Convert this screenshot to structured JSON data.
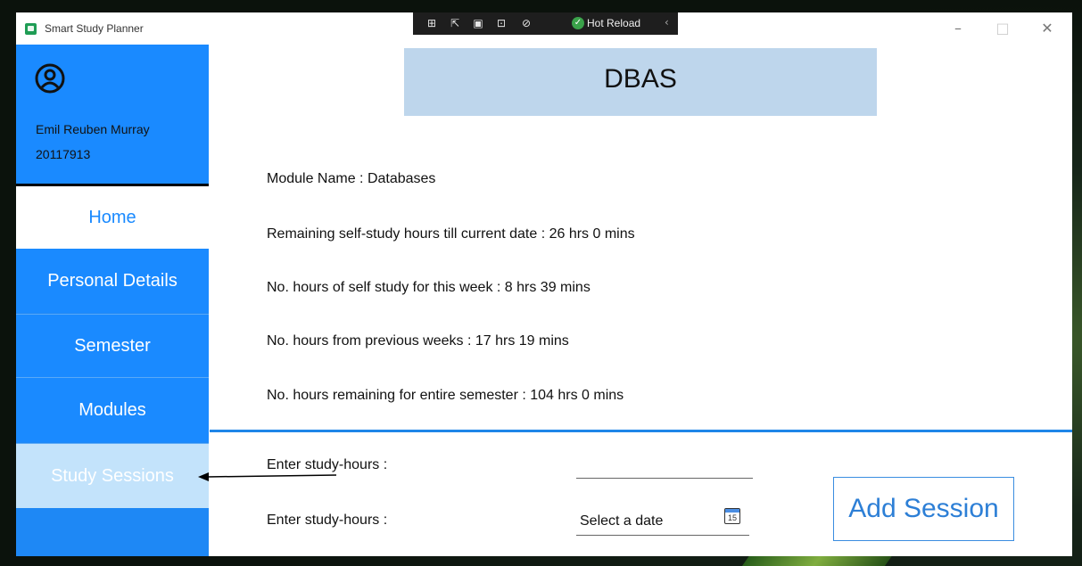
{
  "window": {
    "title": "Smart Study Planner"
  },
  "devtools": {
    "hot_reload_label": "Hot Reload"
  },
  "profile": {
    "name": "Emil Reuben Murray",
    "id": "20117913"
  },
  "nav": {
    "home": "Home",
    "personal_details": "Personal Details",
    "semester": "Semester",
    "modules": "Modules",
    "study_sessions": "Study Sessions"
  },
  "module": {
    "code": "DBAS",
    "name_line": "Module Name : Databases",
    "remaining_till_date": "Remaining self-study hours till current date : 26 hrs 0 mins",
    "this_week": "No. hours of self study for this week : 8 hrs 39 mins",
    "previous_weeks": "No. hours from previous weeks : 17 hrs 19 mins",
    "remaining_semester": "No. hours remaining for entire semester : 104 hrs 0 mins"
  },
  "form": {
    "hours_label": "Enter study-hours :",
    "hours_value": "",
    "date_label": "Enter study-hours :",
    "date_placeholder": "Select a date",
    "calendar_day": "15",
    "add_button": "Add Session"
  },
  "colors": {
    "sidebar": "#1a8aff",
    "selected_nav": "#c3e3fb",
    "header": "#bed6ec",
    "accent": "#1f86e8"
  }
}
